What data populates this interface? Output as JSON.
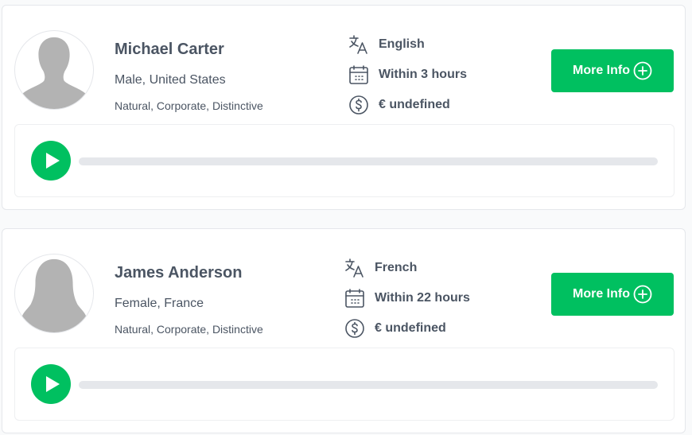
{
  "speakers": [
    {
      "name": "Michael Carter",
      "gender_country": "Male, United States",
      "tags": "Natural, Corporate, Distinctive",
      "language": "English",
      "turnaround": "Within 3 hours",
      "price": "€ undefined",
      "button_label": "More Info",
      "avatar_icon": "male-silhouette-icon",
      "audio_progress": 0
    },
    {
      "name": "James Anderson",
      "gender_country": "Female, France",
      "tags": "Natural, Corporate, Distinctive",
      "language": "French",
      "turnaround": "Within 22 hours",
      "price": "€ undefined",
      "button_label": "More Info",
      "avatar_icon": "female-silhouette-icon",
      "audio_progress": 0
    }
  ],
  "colors": {
    "accent": "#00c060",
    "text": "#4b5563",
    "track": "#e5e7eb",
    "border": "#e5e7eb"
  },
  "icons": {
    "language": "translate-icon",
    "turnaround": "calendar-icon",
    "price": "dollar-circle-icon",
    "more_info": "plus-circle-icon",
    "play": "play-icon"
  }
}
